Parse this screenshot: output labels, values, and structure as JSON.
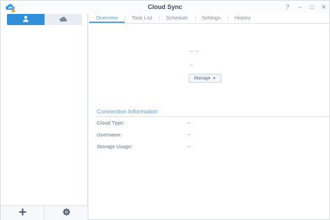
{
  "window": {
    "title": "Cloud Sync",
    "controls": {
      "help": "?",
      "minimize": "–",
      "maximize": "□",
      "close": "✕"
    }
  },
  "sidebar": {
    "segments": [
      {
        "icon": "user-icon",
        "active": true
      },
      {
        "icon": "cloud-icon",
        "active": false
      }
    ],
    "bottom_buttons": [
      {
        "icon": "plus-icon"
      },
      {
        "icon": "gear-icon"
      }
    ]
  },
  "tabs": [
    "Overview",
    "Task List",
    "Schedule",
    "Settings",
    "History"
  ],
  "overview": {
    "status_line_1": "-- --",
    "status_line_2": "--",
    "manage_label": "Manage"
  },
  "connection": {
    "title": "Connection Information",
    "fields": [
      {
        "label": "Cloud Type:",
        "value": "--"
      },
      {
        "label": "Username:",
        "value": "--"
      },
      {
        "label": "Storage Usage:",
        "value": "--"
      }
    ]
  },
  "colors": {
    "accent": "#2f8fd8",
    "link": "#5d9bd1"
  }
}
